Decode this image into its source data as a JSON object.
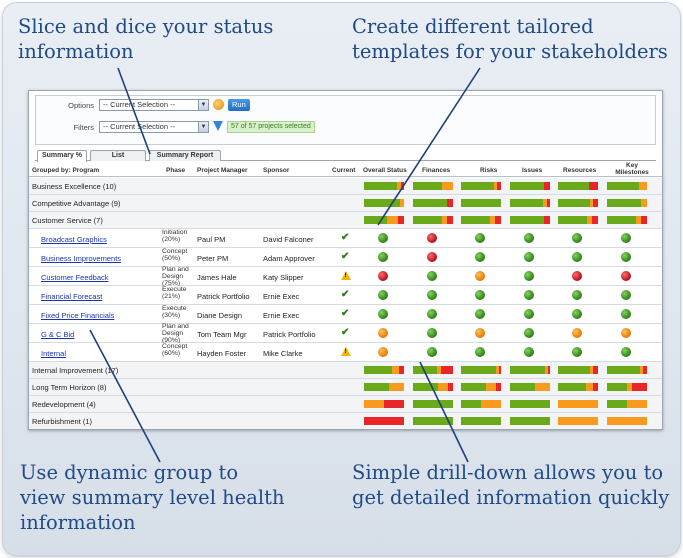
{
  "callouts": {
    "top_left": [
      "Slice and dice your status",
      "information"
    ],
    "top_right": [
      "Create different tailored",
      "templates for your stakeholders"
    ],
    "bottom_left": [
      "Use dynamic group to",
      "view summary level health",
      "information"
    ],
    "bottom_right": [
      "Simple drill-down allows you to",
      "get detailed information quickly"
    ]
  },
  "filters": {
    "options_label": "Options",
    "options_value": "-- Current Selection --",
    "filters_label": "Filters",
    "filters_value": "-- Current Selection --",
    "run_label": "Run",
    "selected_text": "57 of 57 projects selected"
  },
  "tabs": [
    "Summary %",
    "List",
    "Summary Report"
  ],
  "columns": {
    "grouped_by": "Grouped by: Program",
    "phase": "Phase",
    "project_manager": "Project Manager",
    "sponsor": "Sponsor",
    "current": "Current",
    "metrics": [
      "Overall Status",
      "Finances",
      "Risks",
      "Issues",
      "Resources"
    ],
    "key_milestones": [
      "Key",
      "Milestones"
    ]
  },
  "colors": {
    "green": "#6aaa1a",
    "orange": "#f79a1e",
    "red": "#e8262a"
  },
  "groups_top": [
    {
      "name": "Business Excellence (10)",
      "bars": [
        [
          0.82,
          0.1,
          0.08
        ],
        [
          0.72,
          0.28,
          0
        ],
        [
          0.82,
          0.08,
          0.1
        ],
        [
          0.85,
          0,
          0.15
        ],
        [
          0.78,
          0,
          0.22
        ],
        [
          0.8,
          0.2,
          0
        ]
      ]
    },
    {
      "name": "Competitive Advantage (9)",
      "bars": [
        [
          0.9,
          0.1,
          0
        ],
        [
          0.85,
          0,
          0.15
        ],
        [
          1,
          0,
          0
        ],
        [
          0.82,
          0.1,
          0.08
        ],
        [
          0.8,
          0.08,
          0.12
        ],
        [
          0.86,
          0.14,
          0
        ]
      ]
    },
    {
      "name": "Customer Service (7)",
      "bars": [
        [
          0.58,
          0.28,
          0.14
        ],
        [
          0.72,
          0.14,
          0.14
        ],
        [
          0.72,
          0.14,
          0.14
        ],
        [
          0.86,
          0,
          0.14
        ],
        [
          0.72,
          0.14,
          0.14
        ],
        [
          0.72,
          0.14,
          0.14
        ]
      ]
    }
  ],
  "projects": [
    {
      "name": "Broadcast Graphics",
      "phase": [
        "Initiation",
        "(20%)"
      ],
      "pm": "Paul PM",
      "sponsor": "David Falconer",
      "current": "check",
      "dots": [
        "g",
        "r",
        "g",
        "g",
        "g",
        "g"
      ]
    },
    {
      "name": "Business Improvements",
      "phase": [
        "Concept",
        "(50%)"
      ],
      "pm": "Peter PM",
      "sponsor": "Adam Approver",
      "current": "check",
      "dots": [
        "g",
        "r",
        "g",
        "g",
        "g",
        "g"
      ]
    },
    {
      "name": "Customer Feedback",
      "phase": [
        "Plan and",
        "Design",
        "(75%)"
      ],
      "pm": "James Hale",
      "sponsor": "Katy Slipper",
      "current": "warn",
      "dots": [
        "r",
        "g",
        "o",
        "g",
        "r",
        "r"
      ]
    },
    {
      "name": "Financial Forecast",
      "phase": [
        "Execute",
        "(21%)"
      ],
      "pm": "Patrick Portfolio",
      "sponsor": "Ernie Exec",
      "current": "check",
      "dots": [
        "g",
        "g",
        "g",
        "g",
        "g",
        "g"
      ]
    },
    {
      "name": "Fixed Price Financials",
      "phase": [
        "Execute",
        "(30%)"
      ],
      "pm": "Diane Design",
      "sponsor": "Ernie Exec",
      "current": "check",
      "dots": [
        "g",
        "g",
        "g",
        "g",
        "g",
        "g"
      ]
    },
    {
      "name": "G & C Bid",
      "phase": [
        "Plan and",
        "Design",
        "(90%)"
      ],
      "pm": "Tom Team Mgr",
      "sponsor": "Patrick Portfolio",
      "current": "check",
      "dots": [
        "o",
        "g",
        "o",
        "g",
        "o",
        "o"
      ]
    },
    {
      "name": "Internal",
      "phase": [
        "Concept",
        "(60%)"
      ],
      "pm": "Hayden Foster",
      "sponsor": "Mike Clarke",
      "current": "warn",
      "dots": [
        "o",
        "g",
        "g",
        "g",
        "g",
        "g"
      ]
    }
  ],
  "groups_bottom": [
    {
      "name": "Internal Improvement (17)",
      "bars": [
        [
          0.7,
          0.18,
          0.12
        ],
        [
          0.6,
          0.1,
          0.3
        ],
        [
          0.88,
          0.06,
          0.06
        ],
        [
          0.88,
          0.06,
          0.06
        ],
        [
          0.8,
          0.08,
          0.12
        ],
        [
          0.82,
          0.08,
          0.1
        ]
      ]
    },
    {
      "name": "Long Term Horizon (8)",
      "bars": [
        [
          0.62,
          0.38,
          0
        ],
        [
          0.62,
          0.26,
          0.12
        ],
        [
          0.62,
          0.25,
          0.13
        ],
        [
          0.62,
          0.38,
          0
        ],
        [
          0.7,
          0.18,
          0.12
        ],
        [
          0.5,
          0.12,
          0.38
        ]
      ]
    },
    {
      "name": "Redevelopment (4)",
      "bars": [
        [
          0,
          0.5,
          0.5
        ],
        [
          1,
          0,
          0
        ],
        [
          0.5,
          0.5,
          0
        ],
        [
          1,
          0,
          0
        ],
        [
          0,
          1,
          0
        ],
        [
          0.5,
          0.5,
          0
        ]
      ]
    },
    {
      "name": "Refurbishment (1)",
      "bars": [
        [
          0,
          0,
          1
        ],
        [
          1,
          0,
          0
        ],
        [
          1,
          0,
          0
        ],
        [
          1,
          0,
          0
        ],
        [
          0,
          1,
          0
        ],
        [
          0,
          1,
          0
        ]
      ]
    }
  ]
}
